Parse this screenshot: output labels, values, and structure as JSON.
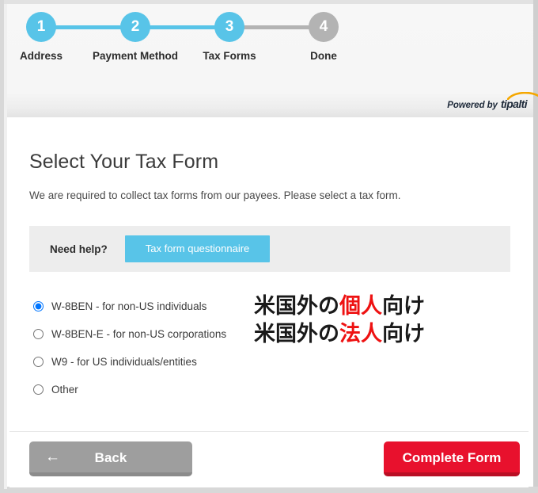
{
  "header": {
    "steps": [
      {
        "number": "1",
        "label": "Address",
        "state": "active"
      },
      {
        "number": "2",
        "label": "Payment Method",
        "state": "active"
      },
      {
        "number": "3",
        "label": "Tax Forms",
        "state": "active"
      },
      {
        "number": "4",
        "label": "Done",
        "state": "inactive"
      }
    ],
    "connectors": [
      "done",
      "done",
      "pending"
    ],
    "powered_by_text": "Powered by",
    "powered_by_brand": "tipalti"
  },
  "main": {
    "title": "Select Your Tax Form",
    "subtitle": "We are required to collect tax forms from our payees. Please select a tax form.",
    "help": {
      "label": "Need help?",
      "button_label": "Tax form questionnaire"
    },
    "options": [
      {
        "id": "w8ben",
        "label": "W-8BEN - for non-US individuals",
        "selected": true
      },
      {
        "id": "w8bene",
        "label": "W-8BEN-E - for non-US corporations",
        "selected": false
      },
      {
        "id": "w9",
        "label": "W9 - for US individuals/entities",
        "selected": false
      },
      {
        "id": "other",
        "label": "Other",
        "selected": false
      }
    ],
    "annotations": [
      {
        "prefix": "米国外の",
        "highlight": "個人",
        "suffix": "向け"
      },
      {
        "prefix": "米国外の",
        "highlight": "法人",
        "suffix": "向け"
      }
    ]
  },
  "footer": {
    "back_label": "Back",
    "back_arrow": "←",
    "complete_label": "Complete Form"
  },
  "colors": {
    "accent_blue": "#58c4e8",
    "inactive_gray": "#b3b3b3",
    "danger_red": "#e8112d",
    "highlight_red": "#ee1111",
    "brand_swoosh": "#f5a700"
  }
}
